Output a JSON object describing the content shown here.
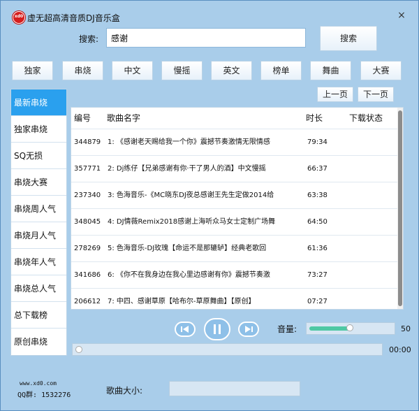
{
  "window": {
    "title": "虚无超高清音质DJ音乐盒",
    "logo_text": "xd0",
    "close_symbol": "×"
  },
  "search": {
    "label": "搜索:",
    "value": "感谢",
    "button_label": "搜索"
  },
  "categories": [
    "独家",
    "串烧",
    "中文",
    "慢摇",
    "英文",
    "榜单",
    "舞曲",
    "大赛"
  ],
  "sidebar": {
    "active_index": 0,
    "items": [
      "最新串烧",
      "独家串烧",
      "SQ无损",
      "串烧大赛",
      "串烧周人气",
      "串烧月人气",
      "串烧年人气",
      "串烧总人气",
      "总下载榜",
      "原创串烧"
    ]
  },
  "paging": {
    "prev_label": "上一页",
    "next_label": "下一页"
  },
  "table": {
    "headers": {
      "id": "编号",
      "name": "歌曲名字",
      "duration": "时长",
      "status": "下载状态"
    },
    "rows": [
      {
        "id": "344879",
        "name": "1: 《感谢老天赐给我一个你》震撼节奏激情无限情感",
        "duration": "79:34",
        "status": ""
      },
      {
        "id": "357771",
        "name": "2: Dj练仔【兄弟感谢有你·干了男人的酒】中文慢摇",
        "duration": "66:37",
        "status": ""
      },
      {
        "id": "237340",
        "name": "3: 色海音乐-《MC晓东DJ夜总感谢王先生定做2014给",
        "duration": "63:38",
        "status": ""
      },
      {
        "id": "348045",
        "name": "4: DJ情薇Remix2018感谢上海听众马女士定制广场舞",
        "duration": "64:50",
        "status": ""
      },
      {
        "id": "278269",
        "name": "5: 色海音乐-DJ玫瑰【命运不是那辘轳】经典老歌回",
        "duration": "61:36",
        "status": ""
      },
      {
        "id": "341686",
        "name": "6: 《你不在我身边在我心里边感谢有你》震撼节奏激",
        "duration": "73:27",
        "status": ""
      },
      {
        "id": "206612",
        "name": "7: 中四、感谢草原【哈布尔-草原舞曲】【原创】",
        "duration": "07:27",
        "status": ""
      }
    ]
  },
  "player": {
    "volume_label": "音量:",
    "volume_value": "50",
    "volume_fraction": 0.5,
    "time": "00:00",
    "progress_fraction": 0.0,
    "controls": [
      "prev-icon",
      "pause-icon",
      "next-icon"
    ]
  },
  "footer": {
    "site": "www.xd0.com",
    "qq": "QQ群: 1532276",
    "size_label": "歌曲大小:",
    "size_value": ""
  },
  "colors": {
    "background": "#a9cdea",
    "sidebar_active": "#2aa0ee",
    "volume_fill": "#4fc8a4"
  }
}
